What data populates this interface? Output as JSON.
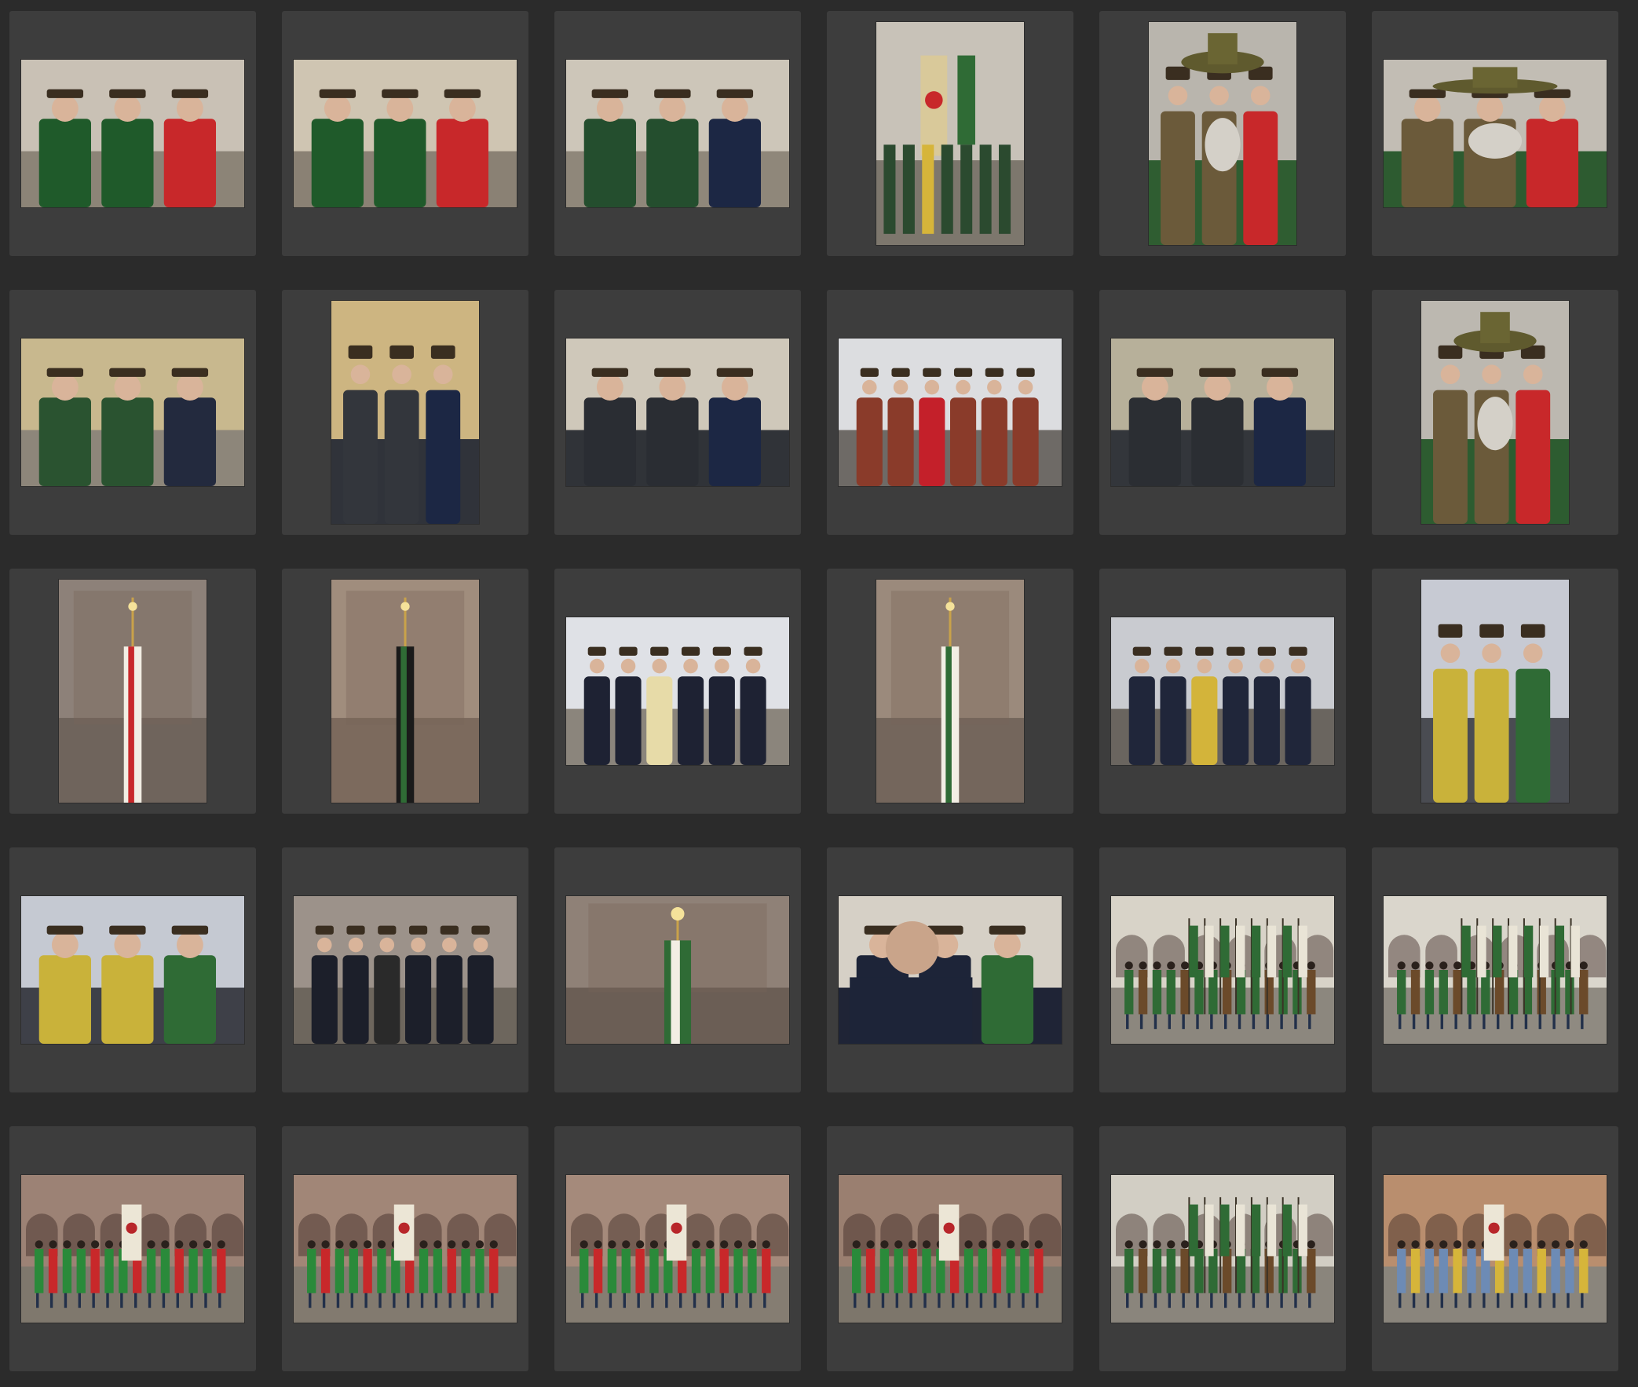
{
  "app": {
    "view": "photo-grid",
    "accent": "#3d3d3d",
    "background": "#2b2b2b"
  },
  "photos": [
    {
      "id": 1,
      "orientation": "landscape",
      "scene": "men-chat",
      "sky": "#c9c1b5",
      "ground": "#8c8477",
      "fig": "#1f5a2a",
      "acc": "#c8282a"
    },
    {
      "id": 2,
      "orientation": "landscape",
      "scene": "men-chat",
      "sky": "#cfc5b2",
      "ground": "#8a8174",
      "fig": "#1f5a2a",
      "acc": "#c8282a"
    },
    {
      "id": 3,
      "orientation": "landscape",
      "scene": "men-chat",
      "sky": "#cdc6b9",
      "ground": "#8f877a",
      "fig": "#244e2e",
      "acc": "#1c2744"
    },
    {
      "id": 4,
      "orientation": "portrait",
      "scene": "flags",
      "sky": "#c8c2b8",
      "ground": "#7d776d",
      "fig": "#d9c99a",
      "acc": "#2f6b35"
    },
    {
      "id": 5,
      "orientation": "portrait",
      "scene": "portrait-hat",
      "sky": "#b9b5ad",
      "ground": "#2f5d31",
      "fig": "#6b5a3a",
      "acc": "#c8282a"
    },
    {
      "id": 6,
      "orientation": "landscape",
      "scene": "portrait-hat",
      "sky": "#c2bdb4",
      "ground": "#2d5b30",
      "fig": "#6b5a3a",
      "acc": "#c8282a"
    },
    {
      "id": 7,
      "orientation": "landscape",
      "scene": "men-chat",
      "sky": "#c8b88e",
      "ground": "#8d867a",
      "fig": "#2a5330",
      "acc": "#232a3e"
    },
    {
      "id": 8,
      "orientation": "portrait",
      "scene": "coat-man",
      "sky": "#cdb581",
      "ground": "#30333a",
      "fig": "#33363c",
      "acc": "#1c2744"
    },
    {
      "id": 9,
      "orientation": "landscape",
      "scene": "coat-man",
      "sky": "#cfc8ba",
      "ground": "#303338",
      "fig": "#2a2d33",
      "acc": "#1c2744"
    },
    {
      "id": 10,
      "orientation": "landscape",
      "scene": "crowd",
      "sky": "#dcdde0",
      "ground": "#6e6a66",
      "fig": "#8a3b2a",
      "acc": "#c4202a"
    },
    {
      "id": 11,
      "orientation": "landscape",
      "scene": "coat-man",
      "sky": "#b7b09a",
      "ground": "#33363b",
      "fig": "#2b2e33",
      "acc": "#1c2744"
    },
    {
      "id": 12,
      "orientation": "portrait",
      "scene": "portrait-hat",
      "sky": "#bcb8b0",
      "ground": "#2d5c30",
      "fig": "#6b5a3a",
      "acc": "#c8282a"
    },
    {
      "id": 13,
      "orientation": "portrait",
      "scene": "banner",
      "sky": "#8d8179",
      "ground": "#6f645c",
      "fig": "#f2eee4",
      "acc": "#c8282a"
    },
    {
      "id": 14,
      "orientation": "portrait",
      "scene": "banner",
      "sky": "#a08d7d",
      "ground": "#7c6a5d",
      "fig": "#1a1a1a",
      "acc": "#2f6b35"
    },
    {
      "id": 15,
      "orientation": "landscape",
      "scene": "women",
      "sky": "#dfe1e6",
      "ground": "#8b857c",
      "fig": "#1e2233",
      "acc": "#e7dba8"
    },
    {
      "id": 16,
      "orientation": "portrait",
      "scene": "banner",
      "sky": "#9b8a7c",
      "ground": "#74665c",
      "fig": "#f2eee4",
      "acc": "#2f6b35"
    },
    {
      "id": 17,
      "orientation": "landscape",
      "scene": "women",
      "sky": "#c9cbd0",
      "ground": "#6a655f",
      "fig": "#20263a",
      "acc": "#d3b43a"
    },
    {
      "id": 18,
      "orientation": "portrait",
      "scene": "yellow-man",
      "sky": "#c7cad3",
      "ground": "#4a4c52",
      "fig": "#c9b23a",
      "acc": "#2f6b35"
    },
    {
      "id": 19,
      "orientation": "landscape",
      "scene": "yellow-man",
      "sky": "#c5c9d2",
      "ground": "#3e4048",
      "fig": "#c9b23a",
      "acc": "#2f6b35"
    },
    {
      "id": 20,
      "orientation": "landscape",
      "scene": "women",
      "sky": "#9c928a",
      "ground": "#6d665d",
      "fig": "#1c1f2a",
      "acc": "#2a2a2a"
    },
    {
      "id": 21,
      "orientation": "landscape",
      "scene": "banner",
      "sky": "#8f8177",
      "ground": "#6b5e55",
      "fig": "#2f6b35",
      "acc": "#f2eee4"
    },
    {
      "id": 22,
      "orientation": "landscape",
      "scene": "suit-profile",
      "sky": "#d6d0c6",
      "ground": "#1f2436",
      "fig": "#1d2438",
      "acc": "#2f6b35"
    },
    {
      "id": 23,
      "orientation": "landscape",
      "scene": "row-flags",
      "sky": "#d8d3c8",
      "ground": "#8c877e",
      "fig": "#2f6b35",
      "acc": "#6b4a2a"
    },
    {
      "id": 24,
      "orientation": "landscape",
      "scene": "row-flags",
      "sky": "#dad6cc",
      "ground": "#8f8a81",
      "fig": "#2f6b35",
      "acc": "#6b4a2a"
    },
    {
      "id": 25,
      "orientation": "landscape",
      "scene": "row-green",
      "sky": "#9c8275",
      "ground": "#7f786d",
      "fig": "#2a8a3a",
      "acc": "#c8282a"
    },
    {
      "id": 26,
      "orientation": "landscape",
      "scene": "row-green",
      "sky": "#a18677",
      "ground": "#827a6f",
      "fig": "#2a8a3a",
      "acc": "#c8282a"
    },
    {
      "id": 27,
      "orientation": "landscape",
      "scene": "row-green",
      "sky": "#a58a7b",
      "ground": "#857d72",
      "fig": "#2a8a3a",
      "acc": "#c8282a"
    },
    {
      "id": 28,
      "orientation": "landscape",
      "scene": "row-green",
      "sky": "#9a7f70",
      "ground": "#7d766b",
      "fig": "#2a8a3a",
      "acc": "#c8282a"
    },
    {
      "id": 29,
      "orientation": "landscape",
      "scene": "row-flags",
      "sky": "#d2cec4",
      "ground": "#8a857c",
      "fig": "#2f6b35",
      "acc": "#6b4a2a"
    },
    {
      "id": 30,
      "orientation": "landscape",
      "scene": "row-blue",
      "sky": "#b98e6e",
      "ground": "#8a857c",
      "fig": "#6d8bb5",
      "acc": "#d6b53a"
    }
  ]
}
